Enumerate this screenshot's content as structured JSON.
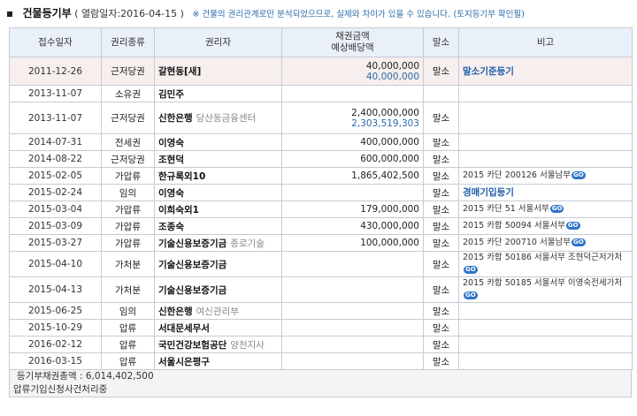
{
  "header": {
    "title": "건물등기부",
    "date": "( 열람일자:2016-04-15 )",
    "note": "※ 건물의 권리관계로만 분석되었으므로, 실제와 차이가 있을 수 있습니다.",
    "link": "(토지등기부 확인필)"
  },
  "columns": [
    "접수일자",
    "권리종류",
    "권리자",
    "채권금액\n예상배당액",
    "말소",
    "비고"
  ],
  "rows": [
    {
      "date": "2011-12-26",
      "type": "근저당권",
      "holder": "갈현동[새]",
      "branch": "",
      "amount": "40,000,000",
      "expected": "40,000,000",
      "ext": "말소",
      "note": "말소기준등기",
      "note_blue": true,
      "go": false,
      "highlight": true
    },
    {
      "date": "2013-11-07",
      "type": "소유권",
      "holder": "김민주",
      "branch": "",
      "amount": "",
      "expected": "",
      "ext": "",
      "note": "",
      "note_blue": false,
      "go": false,
      "highlight": false
    },
    {
      "date": "2013-11-07",
      "type": "근저당권",
      "holder": "신한은행",
      "branch": "당산동금융센터",
      "amount": "2,400,000,000",
      "expected": "2,303,519,303",
      "ext": "말소",
      "note": "",
      "note_blue": false,
      "go": false,
      "highlight": false
    },
    {
      "date": "2014-07-31",
      "type": "전세권",
      "holder": "이영숙",
      "branch": "",
      "amount": "400,000,000",
      "expected": "",
      "ext": "말소",
      "note": "",
      "note_blue": false,
      "go": false,
      "highlight": false
    },
    {
      "date": "2014-08-22",
      "type": "근저당권",
      "holder": "조현덕",
      "branch": "",
      "amount": "600,000,000",
      "expected": "",
      "ext": "말소",
      "note": "",
      "note_blue": false,
      "go": false,
      "highlight": false
    },
    {
      "date": "2015-02-05",
      "type": "가압류",
      "holder": "한규록외10",
      "branch": "",
      "amount": "1,865,402,500",
      "expected": "",
      "ext": "말소",
      "note": "2015 카단 200126 서울남부",
      "note_blue": false,
      "go": true,
      "highlight": false
    },
    {
      "date": "2015-02-24",
      "type": "임의",
      "holder": "이영숙",
      "branch": "",
      "amount": "",
      "expected": "",
      "ext": "말소",
      "note": "경매기입등기",
      "note_blue": true,
      "go": false,
      "highlight": false
    },
    {
      "date": "2015-03-04",
      "type": "가압류",
      "holder": "이희숙외1",
      "branch": "",
      "amount": "179,000,000",
      "expected": "",
      "ext": "말소",
      "note": "2015 카단 51 서울서부",
      "note_blue": false,
      "go": true,
      "highlight": false
    },
    {
      "date": "2015-03-09",
      "type": "가압류",
      "holder": "조종숙",
      "branch": "",
      "amount": "430,000,000",
      "expected": "",
      "ext": "말소",
      "note": "2015 카합 50094 서울서부",
      "note_blue": false,
      "go": true,
      "highlight": false
    },
    {
      "date": "2015-03-27",
      "type": "가압류",
      "holder": "기술신용보증기금",
      "branch": "종로기술",
      "amount": "100,000,000",
      "expected": "",
      "ext": "말소",
      "note": "2015 카단 200710 서울남부",
      "note_blue": false,
      "go": true,
      "highlight": false
    },
    {
      "date": "2015-04-10",
      "type": "가처분",
      "holder": "기술신용보증기금",
      "branch": "",
      "amount": "",
      "expected": "",
      "ext": "말소",
      "note": "2015 카합 50186 서울서부 조현덕근저가처",
      "note_blue": false,
      "go": true,
      "highlight": false
    },
    {
      "date": "2015-04-13",
      "type": "가처분",
      "holder": "기술신용보증기금",
      "branch": "",
      "amount": "",
      "expected": "",
      "ext": "말소",
      "note": "2015 카합 50185 서울서부 이영숙전세가처",
      "note_blue": false,
      "go": true,
      "highlight": false
    },
    {
      "date": "2015-06-25",
      "type": "임의",
      "holder": "신한은행",
      "branch": "여신관리부",
      "amount": "",
      "expected": "",
      "ext": "말소",
      "note": "",
      "note_blue": false,
      "go": false,
      "highlight": false
    },
    {
      "date": "2015-10-29",
      "type": "압류",
      "holder": "서대문세무서",
      "branch": "",
      "amount": "",
      "expected": "",
      "ext": "말소",
      "note": "",
      "note_blue": false,
      "go": false,
      "highlight": false
    },
    {
      "date": "2016-02-12",
      "type": "압류",
      "holder": "국민건강보험공단",
      "branch": "양천지사",
      "amount": "",
      "expected": "",
      "ext": "말소",
      "note": "",
      "note_blue": false,
      "go": false,
      "highlight": false
    },
    {
      "date": "2016-03-15",
      "type": "압류",
      "holder": "서울시은평구",
      "branch": "",
      "amount": "",
      "expected": "",
      "ext": "말소",
      "note": "",
      "note_blue": false,
      "go": false,
      "highlight": false
    }
  ],
  "footer": {
    "total": "등기부채권총액 : 6,014,402,500",
    "process": "압류기입신청사건처리중"
  },
  "go_label": "GO",
  "colors": {
    "header_bg": "#e9f0f9",
    "highlight_bg": "#f7eeee",
    "link_blue": "#2a6aa8",
    "go_blue": "#2e74c8"
  }
}
